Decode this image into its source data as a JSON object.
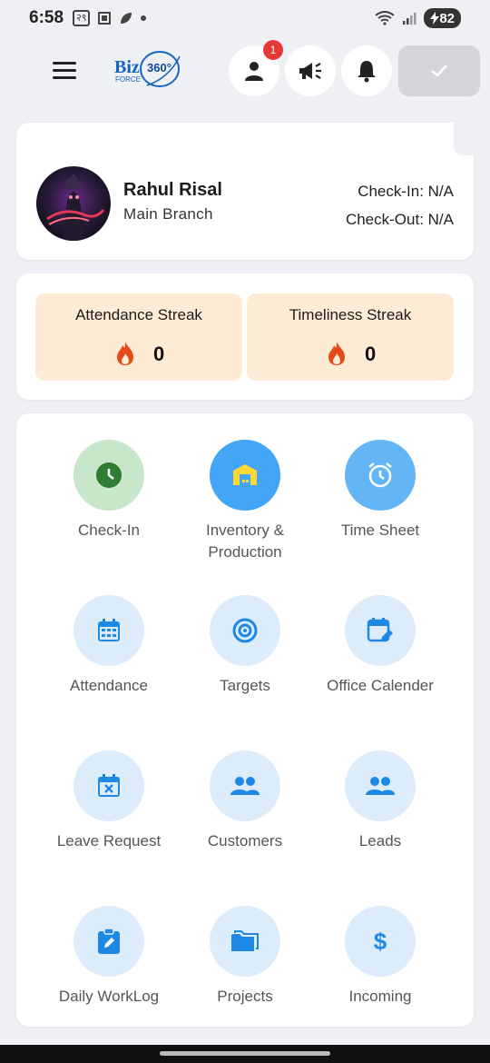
{
  "status_bar": {
    "time": "6:58",
    "battery": "82"
  },
  "header": {
    "logo_text": "Biz",
    "logo_sub": "FORCE",
    "logo_num": "360°",
    "notification_count": "1"
  },
  "profile": {
    "name": "Rahul Risal",
    "branch": "Main Branch",
    "check_in": "Check-In: N/A",
    "check_out": "Check-Out: N/A"
  },
  "streaks": [
    {
      "title": "Attendance Streak",
      "value": "0"
    },
    {
      "title": "Timeliness Streak",
      "value": "0"
    }
  ],
  "menu": [
    {
      "label": "Check-In",
      "icon": "clock-icon"
    },
    {
      "label": "Inventory & Production",
      "icon": "warehouse-icon"
    },
    {
      "label": "Time Sheet",
      "icon": "alarm-clock-icon"
    },
    {
      "label": "Attendance",
      "icon": "calendar-grid-icon"
    },
    {
      "label": "Targets",
      "icon": "target-icon"
    },
    {
      "label": "Office Calender",
      "icon": "calendar-edit-icon"
    },
    {
      "label": "Leave Request",
      "icon": "calendar-x-icon"
    },
    {
      "label": "Customers",
      "icon": "people-icon"
    },
    {
      "label": "Leads",
      "icon": "people-icon"
    },
    {
      "label": "Daily WorkLog",
      "icon": "clipboard-edit-icon"
    },
    {
      "label": "Projects",
      "icon": "folder-icon"
    },
    {
      "label": "Incoming",
      "icon": "dollar-icon"
    }
  ],
  "colors": {
    "accent_blue": "#1e88e5",
    "light_blue_circle": "#dcecfb",
    "checkin_green": "#c8e6c9",
    "checkin_dark_green": "#2e7d32",
    "streak_bg": "#fdebd6",
    "flame_red": "#e64a19"
  }
}
